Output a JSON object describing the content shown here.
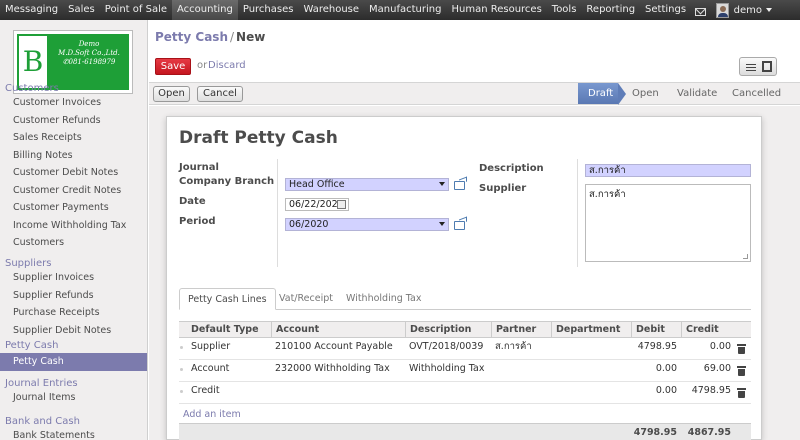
{
  "topbar": {
    "menu": [
      "Messaging",
      "Sales",
      "Point of Sale",
      "Accounting",
      "Purchases",
      "Warehouse",
      "Manufacturing",
      "Human Resources",
      "Tools",
      "Reporting",
      "Settings"
    ],
    "active_menu": "Accounting",
    "user_name": "demo"
  },
  "logo": {
    "line1": "Demo",
    "line2": "M.D.Soft Co.,Ltd.",
    "line3": "081-6198979",
    "letter": "B"
  },
  "sidebar": {
    "sections": [
      {
        "title": "Customers",
        "items": [
          "Customer Invoices",
          "Customer Refunds",
          "Sales Receipts",
          "Billing Notes",
          "Customer Debit Notes",
          "Customer Credit Notes",
          "Customer Payments",
          "Income Withholding Tax",
          "Customers"
        ]
      },
      {
        "title": "Suppliers",
        "items": [
          "Supplier Invoices",
          "Supplier Refunds",
          "Purchase Receipts",
          "Supplier Debit Notes"
        ]
      },
      {
        "title": "Petty Cash",
        "items": [
          "Petty Cash"
        ]
      },
      {
        "title": "Journal Entries",
        "items": [
          "Journal Items"
        ]
      },
      {
        "title": "Bank and Cash",
        "items": [
          "Bank Statements"
        ]
      }
    ],
    "active_item": "Petty Cash"
  },
  "breadcrumb": {
    "parent": "Petty Cash",
    "separator": "/",
    "current": "New"
  },
  "actions": {
    "save": "Save",
    "or": "or",
    "discard": "Discard"
  },
  "statusbar": {
    "buttons": [
      "Open",
      "Cancel"
    ],
    "stages": [
      "Draft",
      "Open",
      "Validate",
      "Cancelled"
    ],
    "active_stage": "Draft"
  },
  "form": {
    "title": "Draft Petty Cash",
    "labels": {
      "journal": "Journal",
      "company_branch": "Company Branch",
      "date": "Date",
      "period": "Period",
      "description": "Description",
      "supplier": "Supplier"
    },
    "company_branch": "Head Office",
    "date": "06/22/2020",
    "period": "06/2020",
    "description": "ส.การค้า",
    "supplier": "ส.การค้า"
  },
  "tabs": [
    "Petty Cash Lines",
    "Vat/Receipt",
    "Withholding Tax"
  ],
  "lines": {
    "columns": [
      "Default Type",
      "Account",
      "Description",
      "Partner",
      "Department",
      "Debit",
      "Credit"
    ],
    "rows": [
      {
        "type": "Supplier",
        "account": "210100 Account Payable",
        "description": "OVT/2018/0039",
        "partner": "ส.การค้า",
        "department": "",
        "debit": "4798.95",
        "credit": "0.00"
      },
      {
        "type": "Account",
        "account": "232000 Withholding Tax",
        "description": "Withholding Tax",
        "partner": "",
        "department": "",
        "debit": "0.00",
        "credit": "69.00"
      },
      {
        "type": "Credit",
        "account": "",
        "description": "",
        "partner": "",
        "department": "",
        "debit": "0.00",
        "credit": "4798.95"
      }
    ],
    "add_item": "Add an item",
    "total_debit": "4798.95",
    "total_credit": "4867.95"
  }
}
